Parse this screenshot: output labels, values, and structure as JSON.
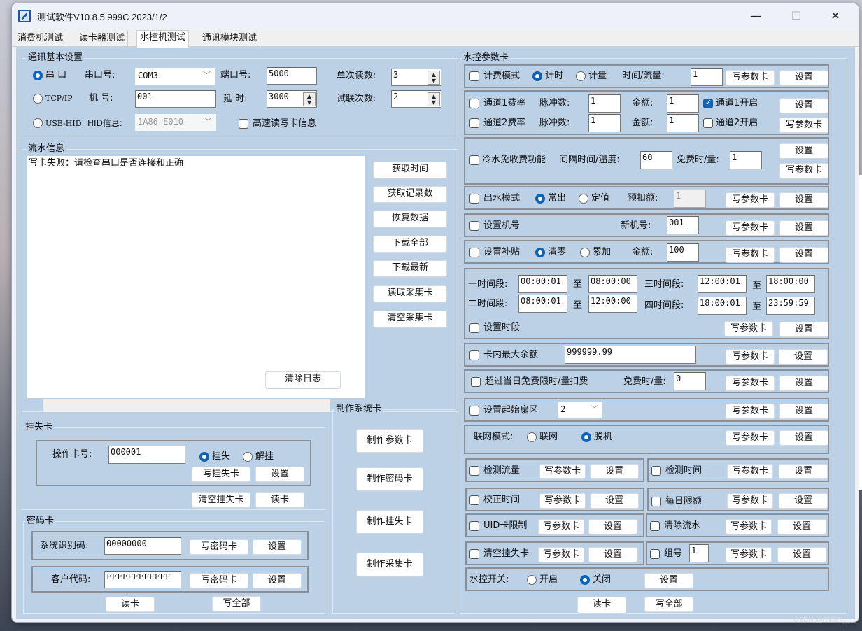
{
  "window": {
    "title": "测试软件V10.8.5 999C  2023/1/2",
    "minimize": "—",
    "maximize": "☐",
    "close": "✕"
  },
  "tabs": [
    {
      "label": "消费机测试",
      "active": false
    },
    {
      "label": "读卡器测试",
      "active": false
    },
    {
      "label": "水控机测试",
      "active": true
    },
    {
      "label": "通讯模块测试",
      "active": false
    }
  ],
  "comm": {
    "group_title": "通讯基本设置",
    "serial_radio": "串  口",
    "serial_port_label": "串口号:",
    "serial_port_value": "COM3",
    "port_label": "端口号:",
    "port_value": "5000",
    "single_read_label": "单次读数:",
    "single_read_value": "3",
    "tcp_radio": "TCP/IP",
    "machine_no_label": "机  号:",
    "machine_no_value": "001",
    "delay_label": "延  时:",
    "delay_value": "3000",
    "retry_label": "试联次数:",
    "retry_value": "2",
    "usb_radio": "USB-HID",
    "hid_label": "HID信息:",
    "hid_value": "1A86 E010",
    "fast_rw_label": "高速读写卡信息",
    "selected": "serial"
  },
  "log": {
    "group_title": "流水信息",
    "text": "写卡失败：请检查串口是否连接和正确",
    "clear_button": "清除日志",
    "side_buttons": [
      "获取时间",
      "获取记录数",
      "恢复数据",
      "下载全部",
      "下载最新",
      "读取采集卡",
      "清空采集卡"
    ]
  },
  "loss_card": {
    "group_title": "挂失卡",
    "card_no_label": "操作卡号:",
    "card_no_value": "000001",
    "radio_loss": "挂失",
    "radio_unloss": "解挂",
    "selected": "loss",
    "write_button": "写挂失卡",
    "set_button": "设置",
    "clear_button": "清空挂失卡",
    "read_button": "读卡"
  },
  "password_card": {
    "group_title": "密码卡",
    "sys_id_label": "系统识别码:",
    "sys_id_value": "00000000",
    "customer_label": "客户代码:",
    "customer_value": "FFFFFFFFFFFF",
    "write_button": "写密码卡",
    "set_button": "设置",
    "read_button": "读卡",
    "write_all_button": "写全部"
  },
  "system_card": {
    "group_title": "制作系统卡",
    "buttons": [
      "制作参数卡",
      "制作密码卡",
      "制作挂失卡",
      "制作采集卡"
    ]
  },
  "param": {
    "group_title": "水控参数卡",
    "write": "写参数卡",
    "set": "设置",
    "billing": {
      "label": "计费模式",
      "radio_time": "计时",
      "radio_volume": "计量",
      "selected": "time",
      "amount_label": "时间/流量:",
      "amount_value": "1"
    },
    "ch1": {
      "label": "通道1费率",
      "pulse_label": "脉冲数:",
      "pulse_value": "1",
      "money_label": "金额:",
      "money_value": "1",
      "enable_label": "通道1开启",
      "enabled": true
    },
    "ch2": {
      "label": "通道2费率",
      "pulse_label": "脉冲数:",
      "pulse_value": "1",
      "money_label": "金额:",
      "money_value": "1",
      "enable_label": "通道2开启",
      "enabled": false
    },
    "cold_water": {
      "label": "冷水免收费功能",
      "interval_label": "间隔时间/温度:",
      "interval_value": "60",
      "free_label": "免费时/量:",
      "free_value": "1"
    },
    "outflow": {
      "label": "出水模式",
      "radio_normal": "常出",
      "radio_fixed": "定值",
      "selected": "normal",
      "prededuct_label": "预扣额:",
      "prededuct_value": "1"
    },
    "machine_no": {
      "label": "设置机号",
      "new_label": "新机号:",
      "new_value": "001"
    },
    "subsidy": {
      "label": "设置补贴",
      "radio_clear": "清零",
      "radio_add": "累加",
      "selected": "clear",
      "amount_label": "金额:",
      "amount_value": "100"
    },
    "periods": {
      "p1_label": "一时间段:",
      "p1_from": "00:00:01",
      "p1_to": "08:00:00",
      "p2_label": "二时间段:",
      "p2_from": "08:00:01",
      "p2_to": "12:00:00",
      "p3_label": "三时间段:",
      "p3_from": "12:00:01",
      "p3_to": "18:00:00",
      "p4_label": "四时间段:",
      "p4_from": "18:00:01",
      "p4_to": "23:59:59",
      "to_label": "至",
      "set_label": "设置时段"
    },
    "max_balance": {
      "label": "卡内最大余额",
      "value": "999999.99"
    },
    "over_free": {
      "label": "超过当日免费限时/量扣费",
      "free_label": "免费时/量:",
      "free_value": "0"
    },
    "start_sector": {
      "label": "设置起始扇区",
      "value": "2"
    },
    "network": {
      "label": "联网模式:",
      "radio_online": "联网",
      "radio_offline": "脱机",
      "selected": "offline"
    },
    "detect_flow": "检测流量",
    "detect_time": "检测时间",
    "calibrate_time": "校正时间",
    "daily_limit": "每日限额",
    "uid_limit": "UID卡限制",
    "clear_flow": "清除流水",
    "clear_loss": "清空挂失卡",
    "group_no": {
      "label": "组号",
      "value": "1"
    },
    "water_switch": {
      "label": "水控开关:",
      "radio_on": "开启",
      "radio_off": "关闭",
      "selected": "off"
    },
    "read_button": "读卡",
    "write_all_button": "写全部"
  },
  "watermark": "CSDN @ITKEY_"
}
